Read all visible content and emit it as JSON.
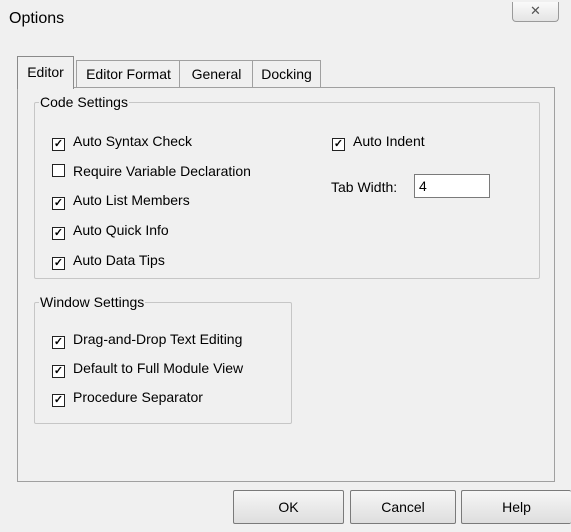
{
  "window": {
    "title": "Options",
    "close_glyph": "✕"
  },
  "tabs": [
    "Editor",
    "Editor Format",
    "General",
    "Docking"
  ],
  "active_tab": "Editor",
  "code_settings": {
    "label": "Code Settings",
    "options": [
      {
        "label": "Auto Syntax Check",
        "checked": true
      },
      {
        "label": "Require Variable Declaration",
        "checked": false
      },
      {
        "label": "Auto List Members",
        "checked": true
      },
      {
        "label": "Auto Quick Info",
        "checked": true
      },
      {
        "label": "Auto Data Tips",
        "checked": true
      }
    ],
    "auto_indent": {
      "label": "Auto Indent",
      "checked": true
    },
    "tab_width": {
      "label": "Tab Width:",
      "value": "4"
    }
  },
  "window_settings": {
    "label": "Window Settings",
    "options": [
      {
        "label": "Drag-and-Drop Text Editing",
        "checked": true
      },
      {
        "label": "Default to Full Module View",
        "checked": true
      },
      {
        "label": "Procedure Separator",
        "checked": true
      }
    ]
  },
  "buttons": {
    "ok": "OK",
    "cancel": "Cancel",
    "help": "Help"
  },
  "check_glyph": "✓"
}
